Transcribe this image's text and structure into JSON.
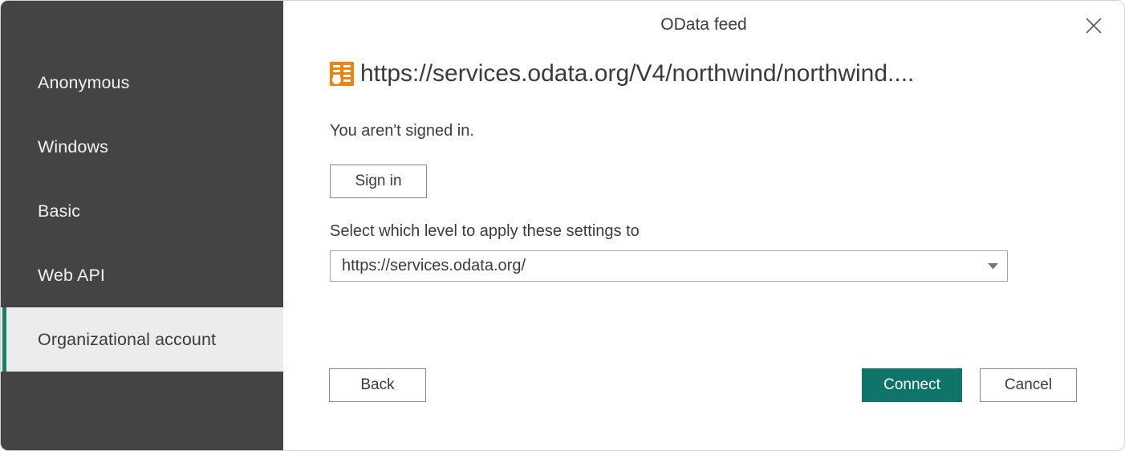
{
  "window": {
    "title": "OData feed",
    "close_icon": "close-icon",
    "border_color": "#d2d2d2"
  },
  "sidebar": {
    "background": "#444444",
    "accent_color": "#1a7f6d",
    "selected_background": "#ececec",
    "items": [
      {
        "label": "Anonymous",
        "selected": false
      },
      {
        "label": "Windows",
        "selected": false
      },
      {
        "label": "Basic",
        "selected": false
      },
      {
        "label": "Web API",
        "selected": false
      },
      {
        "label": "Organizational account",
        "selected": true
      }
    ]
  },
  "main": {
    "source": {
      "icon": "odata-feed-icon",
      "icon_color": "#f2820b",
      "url": "https://services.odata.org/V4/northwind/northwind...."
    },
    "signin_status": "You aren't signed in.",
    "signin_button_label": "Sign in",
    "level_label": "Select which level to apply these settings to",
    "level_select": {
      "value": "https://services.odata.org/",
      "chevron_icon": "chevron-down-icon"
    }
  },
  "footer": {
    "back_label": "Back",
    "connect_label": "Connect",
    "cancel_label": "Cancel",
    "primary_color": "#107569"
  }
}
